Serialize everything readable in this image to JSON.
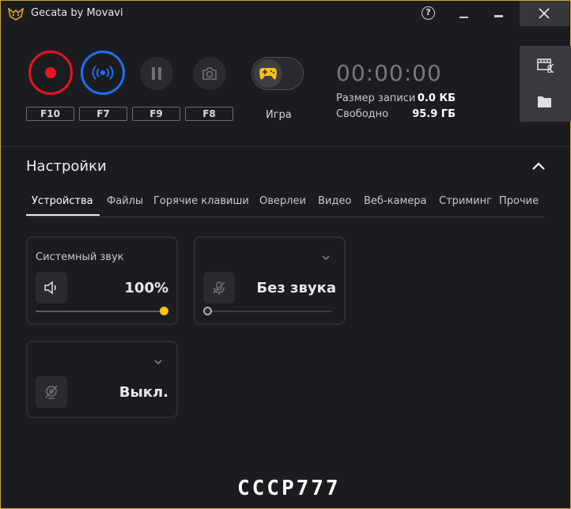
{
  "app": {
    "title": "Gecata by Movavi"
  },
  "window": {
    "help_label": "?"
  },
  "controls": {
    "hotkeys": [
      "F10",
      "F7",
      "F9",
      "F8"
    ],
    "game_mode_label": "Игра",
    "timer": "00:00:00",
    "record_size_label": "Размер записи",
    "record_size_value": "0.0 КБ",
    "free_space_label": "Свободно",
    "free_space_value": "95.9 ГБ"
  },
  "settings": {
    "title": "Настройки",
    "tabs": [
      "Устройства",
      "Файлы",
      "Горячие клавиши",
      "Оверлеи",
      "Видео",
      "Веб-камера",
      "Стриминг",
      "Прочие"
    ],
    "active_tab": "Устройства"
  },
  "devices": {
    "system_audio": {
      "label": "Системный звук",
      "value": "100%",
      "level": 1.0
    },
    "microphone": {
      "label": "",
      "value": "Без звука",
      "level": 0.0
    },
    "webcam": {
      "label": "",
      "value": "Выкл."
    }
  },
  "footer": {
    "text": "CCCP777"
  },
  "colors": {
    "record": "#e8141f",
    "stream": "#1e6ff0",
    "accent": "#f2c21b",
    "border": "#caa63a"
  }
}
